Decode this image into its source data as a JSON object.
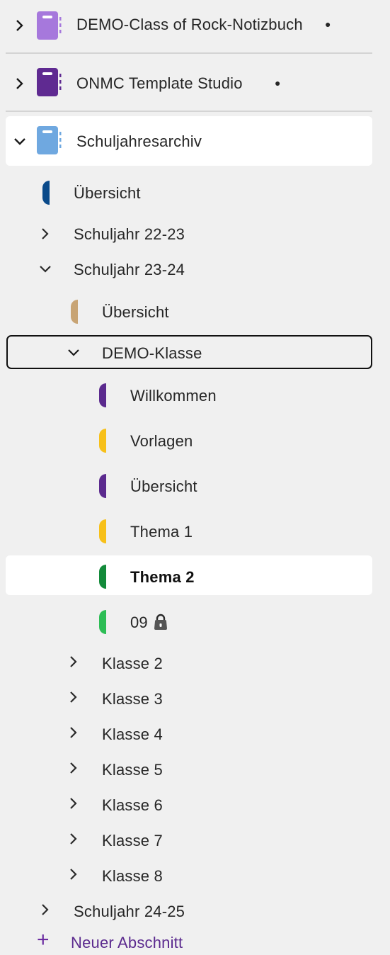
{
  "notebooks": [
    {
      "name": "DEMO-Class of Rock-Notizbuch",
      "color": "#a678dc",
      "sync_dot": "●",
      "expanded": false
    },
    {
      "name": "ONMC Template Studio",
      "color": "#5f2a91",
      "sync_dot": "●",
      "expanded": false
    },
    {
      "name": "Schuljahresarchiv",
      "color": "#6fa8e0",
      "expanded": true
    }
  ],
  "archive": {
    "overview": {
      "label": "Übersicht",
      "color": "#0a4a8a"
    },
    "group_2223": {
      "label": "Schuljahr 22-23",
      "expanded": false
    },
    "group_2324": {
      "label": "Schuljahr 23-24",
      "expanded": true
    },
    "sub_overview": {
      "label": "Übersicht",
      "color": "#c8a474"
    },
    "demo_klasse": {
      "label": "DEMO-Klasse",
      "expanded": true
    },
    "sections": [
      {
        "label": "Willkommen",
        "color": "#5b2a8e"
      },
      {
        "label": "Vorlagen",
        "color": "#f7c019"
      },
      {
        "label": "Übersicht",
        "color": "#5b2a8e"
      },
      {
        "label": "Thema 1",
        "color": "#f7c019"
      },
      {
        "label": "Thema 2",
        "color": "#138a3a",
        "selected": true
      },
      {
        "label": "09",
        "color": "#2dbd55",
        "icon": "lock-icon"
      }
    ],
    "classes": [
      "Klasse 2",
      "Klasse 3",
      "Klasse 4",
      "Klasse 5",
      "Klasse 6",
      "Klasse 7",
      "Klasse 8"
    ],
    "group_2425": {
      "label": "Schuljahr 24-25",
      "expanded": false
    }
  },
  "new_section": {
    "icon": "+",
    "label": "Neuer Abschnitt",
    "color": "#5b2a8e"
  }
}
